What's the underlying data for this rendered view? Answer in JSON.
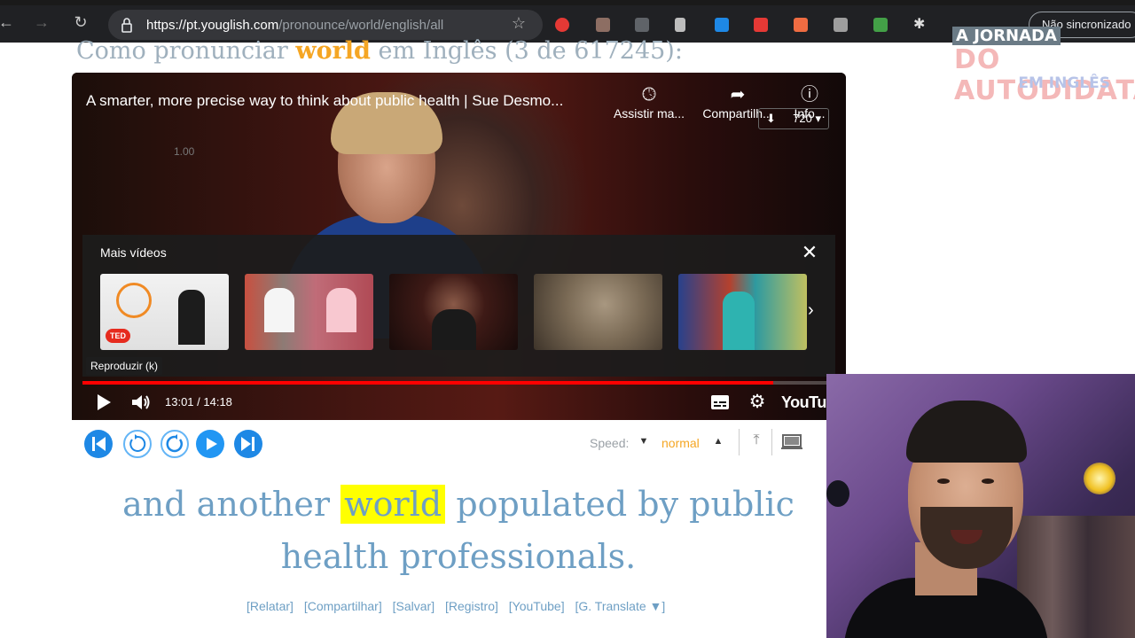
{
  "browser": {
    "url_host": "https://pt.youglish.com",
    "url_path": "/pronounce/world/english/all",
    "sync_label": "Não sincronizado"
  },
  "page": {
    "heading_prefix": "Como pronunciar",
    "heading_word": "world",
    "heading_suffix": "em Inglês (3 de 617245):"
  },
  "logo": {
    "line1": "A JORNADA",
    "line2": "DO AUTODIDATA",
    "line3": "EM INGLÊS"
  },
  "player": {
    "video_title": "A smarter, more precise way to think about public health | Sue Desmo...",
    "watch_later_label": "Assistir ma...",
    "share_label": "Compartilh...",
    "info_label": "Info...",
    "quality_label": "720",
    "ghost_speed": "1.00",
    "more_videos_title": "Mais vídeos",
    "ted_badge": "TED",
    "play_tooltip": "Reproduzir (k)",
    "time": "13:01 / 14:18",
    "progress_fraction": 0.918,
    "youtube_logo": "YouTube"
  },
  "controls": {
    "speed_label": "Speed:",
    "speed_value": "normal"
  },
  "caption": {
    "before": "and another",
    "word": "world",
    "after": "populated by public health professionals."
  },
  "links": [
    "[Relatar]",
    "[Compartilhar]",
    "[Salvar]",
    "[Registro]",
    "[YouTube]",
    "[G. Translate   ▼]"
  ],
  "colors": {
    "accent_orange": "#f5a623",
    "caption_blue": "#6e9fc4",
    "highlight_yellow": "#ffff00",
    "control_blue": "#1e88e5",
    "progress_red": "#ff0000"
  }
}
